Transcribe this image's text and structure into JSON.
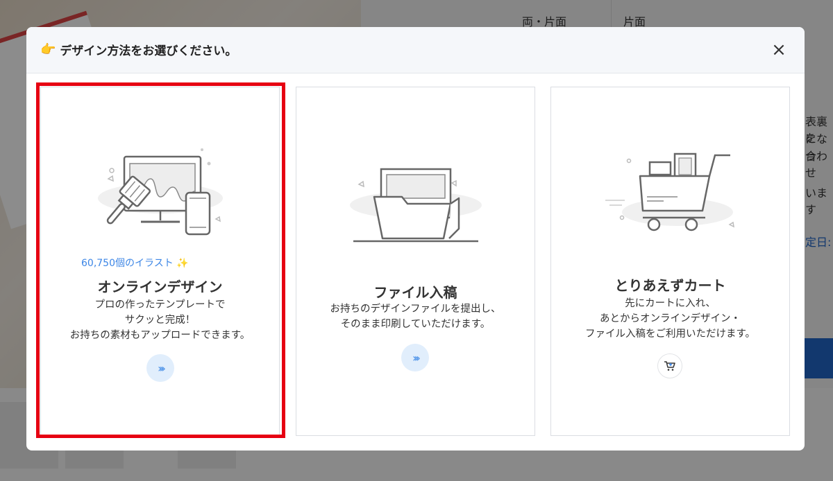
{
  "background": {
    "table_header_label": "両・片面",
    "table_header_value": "片面",
    "side_text_1": "表裏を",
    "side_text_2": "になっ",
    "side_text_3": "合わせ",
    "side_text_4": "います",
    "side_text_5": "定日:"
  },
  "modal": {
    "title": "デザイン方法をお選びください。",
    "title_icon": "pointing-hand-icon",
    "close_label": "×"
  },
  "cards": [
    {
      "badge": "60,750個のイラスト",
      "badge_icon": "sparkle-icon",
      "title": "オンラインデザイン",
      "desc_lines": [
        "プロの作ったテンプレートで",
        "サクッと完成！",
        "お持ちの素材もアップロードできます。"
      ],
      "action_icon": "chevrons-right-icon",
      "selected": true
    },
    {
      "title": "ファイル入稿",
      "desc_lines": [
        "お持ちのデザインファイルを提出し、",
        "そのまま印刷していただけます。"
      ],
      "action_icon": "chevrons-right-icon"
    },
    {
      "title": "とりあえずカート",
      "desc_lines": [
        "先にカートに入れ、",
        "あとからオンラインデザイン・",
        "ファイル入稿をご利用いただけます。"
      ],
      "action_icon": "cart-add-icon"
    }
  ],
  "colors": {
    "highlight": "#e60012",
    "accent_blue": "#3c86e6",
    "arrow_bg": "#e1eefc"
  }
}
